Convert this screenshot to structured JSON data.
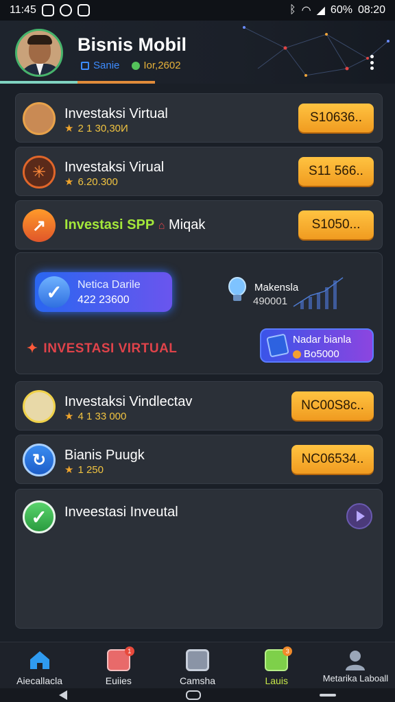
{
  "status": {
    "time": "11:45",
    "battery": "60%",
    "clock": "08:20"
  },
  "header": {
    "title": "Bisnis Mobil",
    "sub1": "Sanie",
    "sub2": "Ior,2602"
  },
  "items": [
    {
      "title": "Investaksi Virtual",
      "meta": "2 1 30,30И",
      "button": "S10636.."
    },
    {
      "title": "Investaksi Virual",
      "meta": "6.20.300",
      "button": "S11 566.."
    },
    {
      "title": "Investasi SPP",
      "title_extra": "Miqak",
      "meta": "",
      "button": "S1050..."
    }
  ],
  "promo": {
    "main_l1": "Netica Darile",
    "main_l2": "422 23600",
    "side_l1": "Makensla",
    "side_l2": "490001",
    "invest_label": "INVESTASI VIRTUAL",
    "btn_l1": "Nadar bianla",
    "btn_l2": "Bo5000"
  },
  "items2": [
    {
      "title": "Investaksi Vindlectav",
      "meta": "4 1 33 000",
      "button": "NC00S8c.."
    },
    {
      "title": "Bianis Puugk",
      "meta": "1 250",
      "button": "NC06534.."
    }
  ],
  "big": {
    "title": "Inveestasi Inveutal"
  },
  "nav": [
    {
      "label": "Aiecallacla",
      "icon": "home-icon",
      "badge": ""
    },
    {
      "label": "Euiies",
      "icon": "profile-card-icon",
      "badge": "1"
    },
    {
      "label": "Camsha",
      "icon": "device-icon",
      "badge": ""
    },
    {
      "label": "Lauis",
      "icon": "dice-icon",
      "badge": "3"
    },
    {
      "label": "Metarika Laboall",
      "icon": "user-icon",
      "badge": ""
    }
  ]
}
